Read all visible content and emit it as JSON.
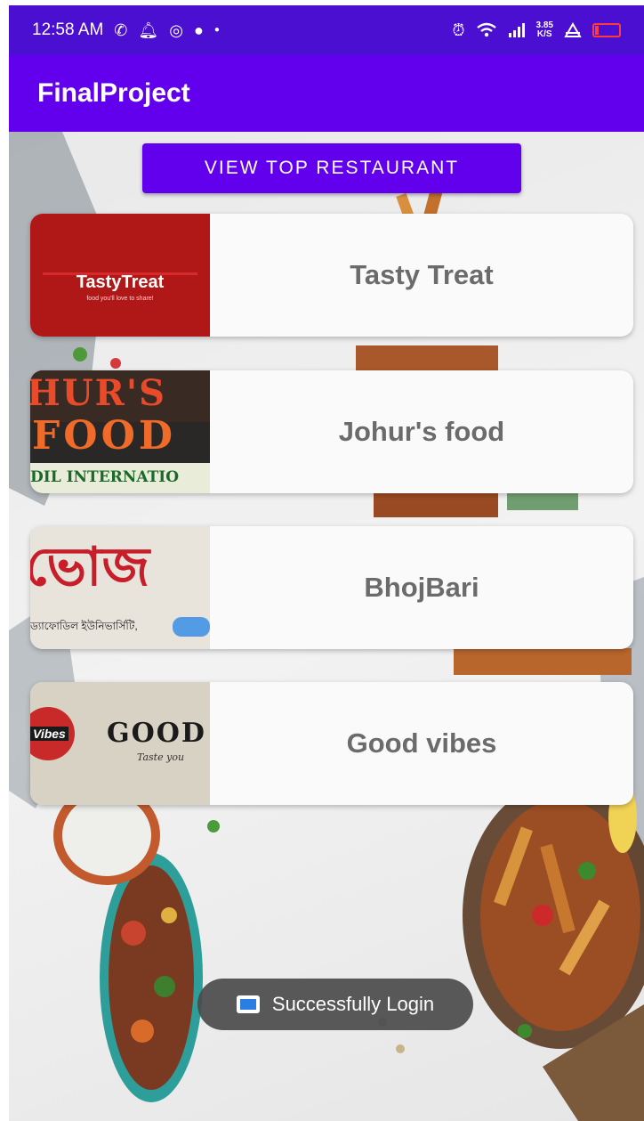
{
  "status_bar": {
    "time": "12:58 AM",
    "left_icons": [
      "phone-icon",
      "bell-icon",
      "instagram-icon",
      "chat-icon",
      "dot-icon"
    ],
    "network_speed_value": "3.85",
    "network_speed_unit": "K/S",
    "right_icons": [
      "alarm-icon",
      "wifi-icon",
      "signal-icon",
      "vpn-icon",
      "battery-icon"
    ],
    "battery_level": 0.15
  },
  "app_bar": {
    "title": "FinalProject"
  },
  "top_button": {
    "label": "VIEW TOP RESTAURANT"
  },
  "restaurants": [
    {
      "name": "Tasty Treat",
      "logo_text": "TastyTreat",
      "logo_tagline": "food you'll love to share!"
    },
    {
      "name": "Johur's food",
      "sign_line1": "HUR'S",
      "sign_line2": "FOOD",
      "sign_line3": "DIL INTERNATIO"
    },
    {
      "name": "BhojBari",
      "sign_big": "ভোজ",
      "sign_small": "ড্যাফোডিল ইউনিভার্সিটি,"
    },
    {
      "name": "Good vibes",
      "sign_left": "Vibes",
      "sign_main": "GOOD",
      "sign_tag": "Taste you"
    }
  ],
  "toast": {
    "message": "Successfully Login"
  },
  "colors": {
    "primary": "#6200ee",
    "status_bar": "#4a0fd0",
    "card_text": "#6b6b6b"
  }
}
